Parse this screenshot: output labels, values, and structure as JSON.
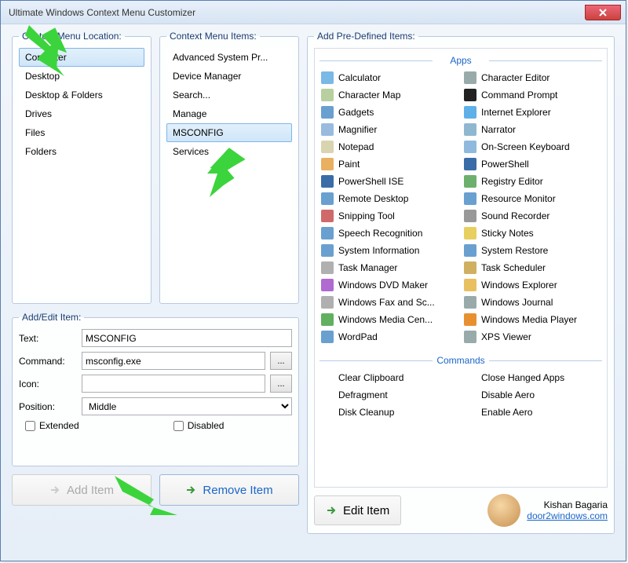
{
  "window": {
    "title": "Ultimate Windows Context Menu Customizer"
  },
  "loc": {
    "legend": "Context Menu Location:",
    "items": [
      "Computer",
      "Desktop",
      "Desktop & Folders",
      "Drives",
      "Files",
      "Folders"
    ],
    "selected": 0
  },
  "items": {
    "legend": "Context Menu Items:",
    "list": [
      "Advanced System Pr...",
      "Device Manager",
      "Search...",
      "Manage",
      "MSCONFIG",
      "Services"
    ],
    "selected": 4
  },
  "predef": {
    "legend": "Add Pre-Defined Items:",
    "apps_header": "Apps",
    "commands_header": "Commands",
    "apps": [
      {
        "label": "Calculator",
        "color": "#7ab8e6"
      },
      {
        "label": "Character Editor",
        "color": "#9aa"
      },
      {
        "label": "Character Map",
        "color": "#b8cfa0"
      },
      {
        "label": "Command Prompt",
        "color": "#222"
      },
      {
        "label": "Gadgets",
        "color": "#6aa0d0"
      },
      {
        "label": "Internet Explorer",
        "color": "#5fb0e8"
      },
      {
        "label": "Magnifier",
        "color": "#99bbdd"
      },
      {
        "label": "Narrator",
        "color": "#8fb8d0"
      },
      {
        "label": "Notepad",
        "color": "#d9d4b0"
      },
      {
        "label": "On-Screen Keyboard",
        "color": "#8fbadd"
      },
      {
        "label": "Paint",
        "color": "#e8b060"
      },
      {
        "label": "PowerShell",
        "color": "#3a6ca8"
      },
      {
        "label": "PowerShell ISE",
        "color": "#3a6ca8"
      },
      {
        "label": "Registry Editor",
        "color": "#6db06d"
      },
      {
        "label": "Remote Desktop",
        "color": "#6aa0d0"
      },
      {
        "label": "Resource Monitor",
        "color": "#6aa0d0"
      },
      {
        "label": "Snipping Tool",
        "color": "#d06a6a"
      },
      {
        "label": "Sound Recorder",
        "color": "#999"
      },
      {
        "label": "Speech Recognition",
        "color": "#6aa0d0"
      },
      {
        "label": "Sticky Notes",
        "color": "#e8d060"
      },
      {
        "label": "System Information",
        "color": "#6aa0d0"
      },
      {
        "label": "System Restore",
        "color": "#6aa0d0"
      },
      {
        "label": "Task Manager",
        "color": "#b0b0b0"
      },
      {
        "label": "Task Scheduler",
        "color": "#d0b060"
      },
      {
        "label": "Windows DVD Maker",
        "color": "#b06ad0"
      },
      {
        "label": "Windows Explorer",
        "color": "#e8c060"
      },
      {
        "label": "Windows Fax and Sc...",
        "color": "#b0b0b0"
      },
      {
        "label": "Windows Journal",
        "color": "#9aa"
      },
      {
        "label": "Windows Media Cen...",
        "color": "#60b060"
      },
      {
        "label": "Windows Media Player",
        "color": "#e89030"
      },
      {
        "label": "WordPad",
        "color": "#6aa0d0"
      },
      {
        "label": "XPS Viewer",
        "color": "#9aa"
      }
    ],
    "commands": [
      {
        "label": "Clear Clipboard"
      },
      {
        "label": "Close Hanged Apps"
      },
      {
        "label": "Defragment"
      },
      {
        "label": "Disable Aero"
      },
      {
        "label": "Disk Cleanup"
      },
      {
        "label": "Enable Aero"
      }
    ]
  },
  "edit": {
    "legend": "Add/Edit Item:",
    "text_label": "Text:",
    "command_label": "Command:",
    "icon_label": "Icon:",
    "position_label": "Position:",
    "text_value": "MSCONFIG",
    "command_value": "msconfig.exe",
    "icon_value": "",
    "position_value": "Middle",
    "browse": "...",
    "extended": "Extended",
    "disabled": "Disabled"
  },
  "buttons": {
    "add": "Add Item",
    "remove": "Remove Item",
    "edititem": "Edit Item"
  },
  "credit": {
    "name": "Kishan Bagaria",
    "site": "door2windows.com"
  }
}
